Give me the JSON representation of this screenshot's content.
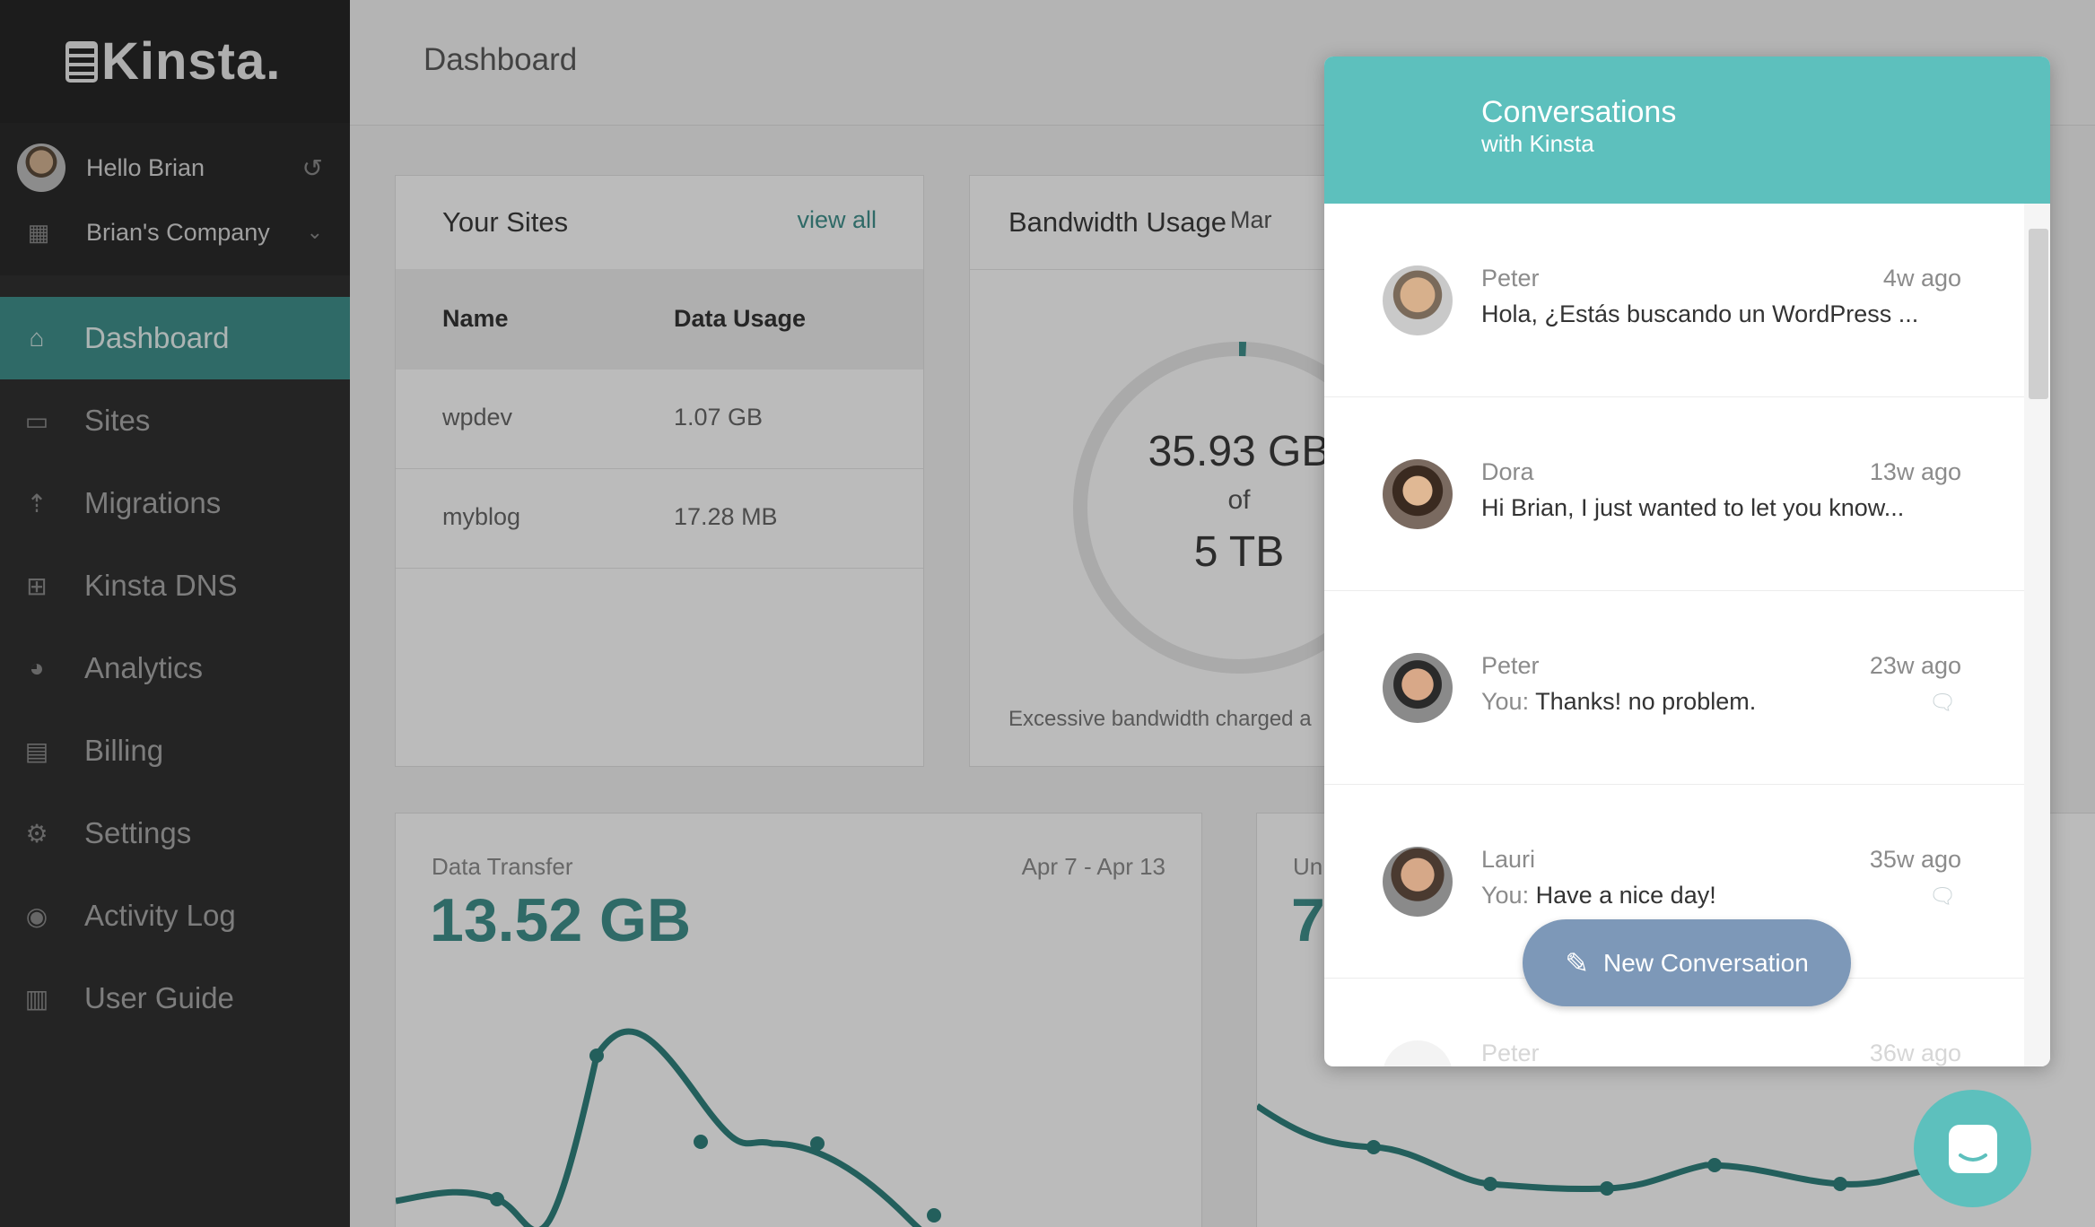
{
  "app": {
    "logo": "Kinsta."
  },
  "user": {
    "greeting": "Hello Brian",
    "company": "Brian's Company"
  },
  "nav": [
    {
      "label": "Dashboard",
      "icon": "home-icon",
      "active": true
    },
    {
      "label": "Sites",
      "icon": "laptop-icon"
    },
    {
      "label": "Migrations",
      "icon": "upload-icon"
    },
    {
      "label": "Kinsta DNS",
      "icon": "grid-icon"
    },
    {
      "label": "Analytics",
      "icon": "pie-chart-icon"
    },
    {
      "label": "Billing",
      "icon": "credit-card-icon"
    },
    {
      "label": "Settings",
      "icon": "gear-icon"
    },
    {
      "label": "Activity Log",
      "icon": "eye-icon"
    },
    {
      "label": "User Guide",
      "icon": "book-icon"
    }
  ],
  "page": {
    "title": "Dashboard"
  },
  "sites": {
    "title": "Your Sites",
    "view_all": "view all",
    "headers": [
      "Name",
      "Data Usage"
    ],
    "rows": [
      {
        "name": "wpdev",
        "usage": "1.07 GB"
      },
      {
        "name": "myblog",
        "usage": "17.28 MB"
      }
    ]
  },
  "bandwidth": {
    "title": "Bandwidth Usage",
    "period": "Mar",
    "used": "35.93 GB",
    "of": "of",
    "total": "5 TB",
    "used_fraction": 0.007,
    "note": "Excessive bandwidth charged a"
  },
  "transfer": {
    "label": "Data Transfer",
    "value": "13.52 GB",
    "range": "Apr 7 - Apr 13"
  },
  "visitors": {
    "label": "Un",
    "value": "7"
  },
  "chat": {
    "title": "Conversations",
    "subtitle": "with Kinsta",
    "conversations": [
      {
        "name": "Peter",
        "time": "4w ago",
        "prefix": "",
        "message": "Hola, ¿Estás buscando un WordPress ..."
      },
      {
        "name": "Dora",
        "time": "13w ago",
        "prefix": "",
        "message": "Hi Brian, I just wanted to let you know..."
      },
      {
        "name": "Peter",
        "time": "23w ago",
        "prefix": "You:",
        "message": "Thanks! no problem."
      },
      {
        "name": "Lauri",
        "time": "35w ago",
        "prefix": "You:",
        "message": "Have a nice day!"
      },
      {
        "name": "Peter",
        "time": "36w ago",
        "prefix": "",
        "message": ""
      }
    ],
    "new_button": "New Conversation"
  },
  "colors": {
    "accent": "#5dc0bd",
    "sidebar": "#303030",
    "active_nav": "#3f8e8a",
    "button": "#7d98b8"
  }
}
